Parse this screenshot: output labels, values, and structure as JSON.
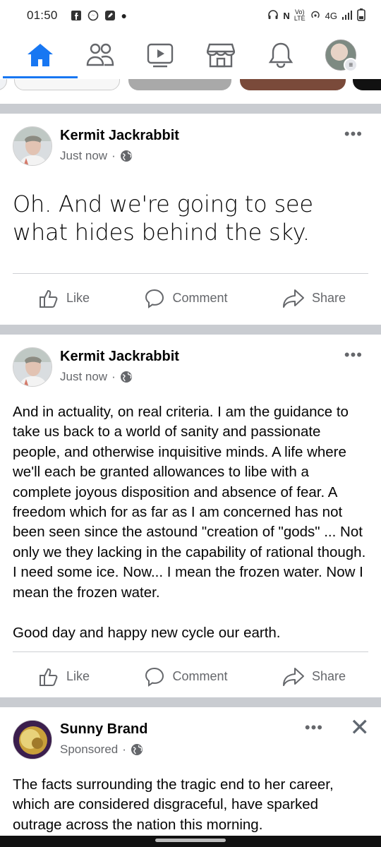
{
  "status_bar": {
    "time": "01:50",
    "network": "4G"
  },
  "nav": {
    "items": [
      {
        "name": "home",
        "icon": "home-icon"
      },
      {
        "name": "friends",
        "icon": "friends-icon"
      },
      {
        "name": "watch",
        "icon": "video-icon"
      },
      {
        "name": "marketplace",
        "icon": "marketplace-icon"
      },
      {
        "name": "notifications",
        "icon": "bell-icon"
      },
      {
        "name": "menu",
        "icon": "avatar-icon"
      }
    ]
  },
  "posts": [
    {
      "author": "Kermit Jackrabbit",
      "time": "Just now",
      "text": "Oh. And we're going to see what hides behind the sky.",
      "actions": {
        "like": "Like",
        "comment": "Comment",
        "share": "Share"
      }
    },
    {
      "author": "Kermit Jackrabbit",
      "time": "Just now",
      "text_p1": "And in actuality, on real criteria. I am the guidance to take us back to a world of sanity and passionate people, and otherwise inquisitive minds. A life where we'll each be granted allowances to libe with a complete joyous disposition and absence of fear. A freedom which for as far as I am concerned has not been seen since the astound \"creation of \"gods\" ... Not only we they lacking in the capability of rational though. I need some ice. Now... I mean the frozen water. Now I mean the frozen water.",
      "text_p2": "Good day and happy new cycle our earth.",
      "actions": {
        "like": "Like",
        "comment": "Comment",
        "share": "Share"
      }
    },
    {
      "author": "Sunny Brand",
      "time": "Sponsored",
      "text": "The facts surrounding the tragic end to her career, which are considered disgraceful, have sparked outrage across the nation this morning."
    }
  ],
  "colors": {
    "accent": "#1877f2",
    "separator": "#c9ccd1",
    "secondary_text": "#65676b"
  }
}
